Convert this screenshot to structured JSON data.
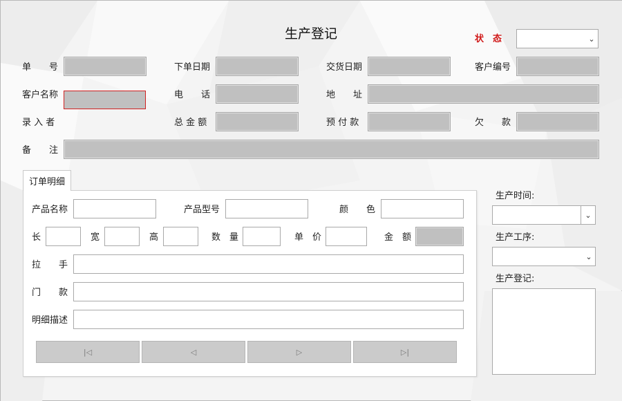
{
  "title": "生产登记",
  "status": {
    "label": "状　态",
    "value": ""
  },
  "header_fields": {
    "order_no": "单　　号",
    "order_date": "下单日期",
    "delivery_date": "交货日期",
    "customer_no": "客户编号",
    "customer_name": "客户名称",
    "phone": "电　　话",
    "address": "地　　址",
    "entered_by": "录 入 者",
    "total_amount": "总 金 额",
    "prepaid": "预 付 款",
    "owed": "欠　　款",
    "remark": "备　　注"
  },
  "tab": {
    "label": "订单明细"
  },
  "detail_fields": {
    "product_name": "产品名称",
    "product_model": "产品型号",
    "color": "颜　　色",
    "length": "长",
    "width": "宽",
    "height": "高",
    "quantity": "数　量",
    "unit_price": "单　价",
    "amount": "金　额",
    "handle": "拉　　手",
    "door_style": "门　　款",
    "description": "明细描述"
  },
  "nav": {
    "first": "|◁",
    "prev": "◁",
    "next": "▷",
    "last": "▷|"
  },
  "side": {
    "production_time": "生产时间:",
    "production_process": "生产工序:",
    "production_record": "生产登记:"
  },
  "colors": {
    "status_label": "#d01818",
    "readonly_field": "#c0c0c0"
  }
}
